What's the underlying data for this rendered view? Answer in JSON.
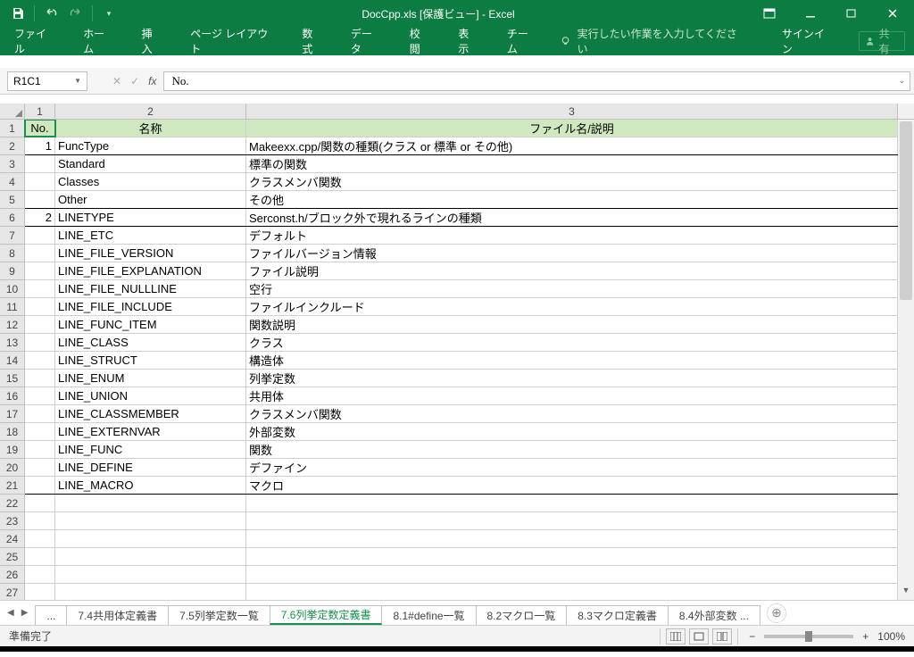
{
  "title": "DocCpp.xls  [保護ビュー] - Excel",
  "ribbon": {
    "file": "ファイル",
    "home": "ホーム",
    "insert": "挿入",
    "layout": "ページ レイアウト",
    "formula": "数式",
    "data": "データ",
    "review": "校閲",
    "view": "表示",
    "team": "チーム",
    "tell": "実行したい作業を入力してください",
    "signin": "サインイン",
    "share": "共有"
  },
  "namebox": "R1C1",
  "formula": "No.",
  "colheaders": {
    "c1": "1",
    "c2": "2",
    "c3": "3"
  },
  "headerRow": {
    "no": "No.",
    "name": "名称",
    "desc": "ファイル名/説明"
  },
  "rows": [
    {
      "no": "1",
      "name": "FuncType",
      "desc": "Makeexx.cpp/関数の種類(クラス or 標準 or その他)",
      "ul": true
    },
    {
      "no": "",
      "name": "Standard",
      "desc": "標準の関数"
    },
    {
      "no": "",
      "name": "Classes",
      "desc": "クラスメンバ関数"
    },
    {
      "no": "",
      "name": "Other",
      "desc": "その他",
      "ul": true
    },
    {
      "no": "2",
      "name": "LINETYPE",
      "desc": "Serconst.h/ブロック外で現れるラインの種類",
      "ul": true
    },
    {
      "no": "",
      "name": "LINE_ETC",
      "desc": "デフォルト"
    },
    {
      "no": "",
      "name": "LINE_FILE_VERSION",
      "desc": "ファイルバージョン情報"
    },
    {
      "no": "",
      "name": "LINE_FILE_EXPLANATION",
      "desc": "ファイル説明"
    },
    {
      "no": "",
      "name": "LINE_FILE_NULLLINE",
      "desc": "空行"
    },
    {
      "no": "",
      "name": "LINE_FILE_INCLUDE",
      "desc": "ファイルインクルード"
    },
    {
      "no": "",
      "name": "LINE_FUNC_ITEM",
      "desc": "関数説明"
    },
    {
      "no": "",
      "name": "LINE_CLASS",
      "desc": "クラス"
    },
    {
      "no": "",
      "name": "LINE_STRUCT",
      "desc": "構造体"
    },
    {
      "no": "",
      "name": "LINE_ENUM",
      "desc": "列挙定数"
    },
    {
      "no": "",
      "name": "LINE_UNION",
      "desc": "共用体"
    },
    {
      "no": "",
      "name": "LINE_CLASSMEMBER",
      "desc": "クラスメンバ関数"
    },
    {
      "no": "",
      "name": "LINE_EXTERNVAR",
      "desc": "外部変数"
    },
    {
      "no": "",
      "name": "LINE_FUNC",
      "desc": "関数"
    },
    {
      "no": "",
      "name": "LINE_DEFINE",
      "desc": "デファイン"
    },
    {
      "no": "",
      "name": "LINE_MACRO",
      "desc": "マクロ",
      "ul": true
    }
  ],
  "emptyRows": 6,
  "sheetTabs": {
    "dots": "...",
    "t1": "7.4共用体定義書",
    "t2": "7.5列挙定数一覧",
    "t3": "7.6列挙定数定義書",
    "t4": "8.1#define一覧",
    "t5": "8.2マクロ一覧",
    "t6": "8.3マクロ定義書",
    "t7": "8.4外部変数 ..."
  },
  "status": {
    "ready": "準備完了",
    "zoom": "100%"
  }
}
